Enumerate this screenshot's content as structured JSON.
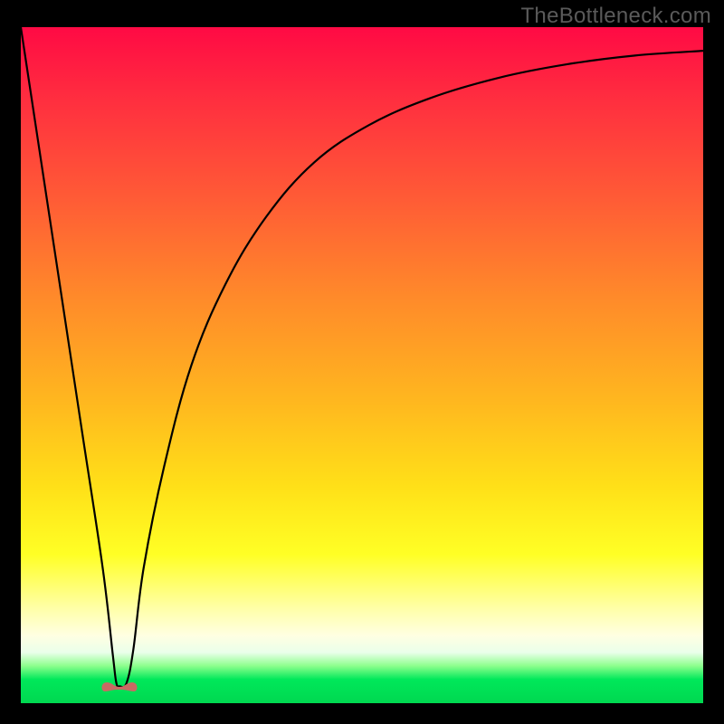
{
  "watermark": "TheBottleneck.com",
  "chart_data": {
    "type": "line",
    "title": "",
    "xlabel": "",
    "ylabel": "",
    "xlim": [
      0,
      100
    ],
    "ylim": [
      0,
      100
    ],
    "grid": false,
    "legend": false,
    "series": [
      {
        "name": "bottleneck-curve",
        "x": [
          0,
          3,
          6,
          9,
          12,
          13.5,
          14,
          14.5,
          15.5,
          16.5,
          18,
          21,
          25,
          30,
          36,
          43,
          51,
          60,
          70,
          80,
          90,
          100
        ],
        "y": [
          100,
          80,
          60,
          40,
          20,
          7,
          3,
          2.5,
          3,
          8,
          20,
          35,
          50,
          62,
          72,
          80,
          85.5,
          89.5,
          92.5,
          94.5,
          95.8,
          96.5
        ]
      }
    ],
    "marker": {
      "name": "dip-marker",
      "x": 14.5,
      "y": 2.5,
      "color": "#c96a63",
      "shape": "rounded-double-lobe"
    },
    "background": {
      "type": "vertical-gradient",
      "stops": [
        {
          "pos": 0.0,
          "color": "#ff0a44"
        },
        {
          "pos": 0.11,
          "color": "#ff2f3f"
        },
        {
          "pos": 0.25,
          "color": "#ff5a36"
        },
        {
          "pos": 0.4,
          "color": "#ff8a2a"
        },
        {
          "pos": 0.55,
          "color": "#ffb61f"
        },
        {
          "pos": 0.68,
          "color": "#ffe018"
        },
        {
          "pos": 0.78,
          "color": "#ffff25"
        },
        {
          "pos": 0.86,
          "color": "#ffffa8"
        },
        {
          "pos": 0.9,
          "color": "#ffffe2"
        },
        {
          "pos": 0.925,
          "color": "#eaffea"
        },
        {
          "pos": 0.945,
          "color": "#8cff8c"
        },
        {
          "pos": 0.965,
          "color": "#00e85a"
        },
        {
          "pos": 1.0,
          "color": "#00d850"
        }
      ]
    }
  }
}
